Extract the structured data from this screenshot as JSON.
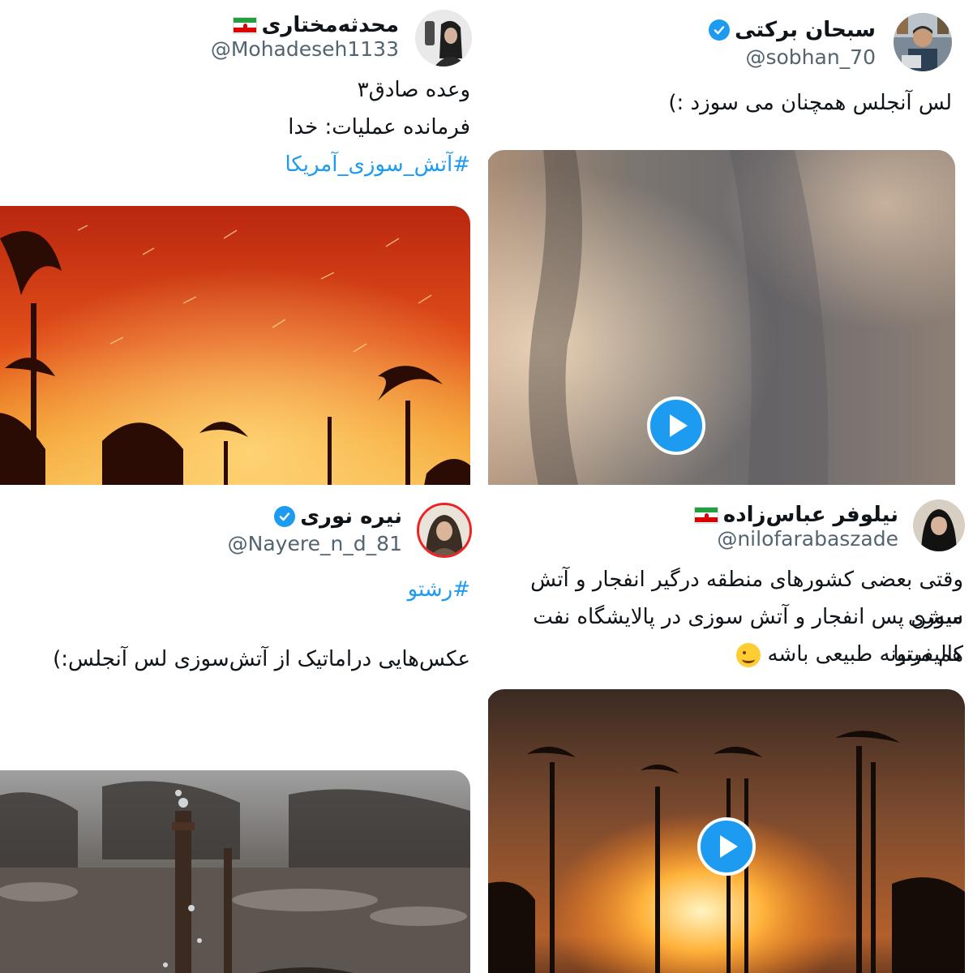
{
  "tweets": [
    {
      "name": "سبحان برکتی",
      "handle": "@sobhan_70",
      "verified": true,
      "text": "لس آنجلس همچنان می سوزد :)",
      "media": "video",
      "avatar_icon": "profile-photo-man-laptop"
    },
    {
      "name": "محدثه‌مختاری",
      "handle": "@Mohadeseh1133",
      "flag": "iran-flag",
      "lines": [
        "وعده صادق۳",
        "فرمانده عملیات: خدا"
      ],
      "hashtag": "#آتش_سوزی_آمریکا",
      "media": "image",
      "avatar_icon": "profile-photo-woman"
    },
    {
      "name": "نیلوفر عباس‌زاده",
      "handle": "@nilofarabaszade",
      "flag": "iran-flag",
      "lines": [
        "وقتی بعضی کشورهای منطقه درگیر انفجار و آتش سوزی",
        "میشن پس انفجار و آتش سوزی در پالایشگاه نفت کالیفرنیا",
        "هم میتونه طبیعی باشه"
      ],
      "emoji": "winking-face-emoji",
      "media": "video",
      "avatar_icon": "profile-photo-woman-chador"
    },
    {
      "name": "نیره نوری",
      "handle": "@Nayere_n_d_81",
      "verified": true,
      "hashtag": "#رشتو",
      "text": "عکس‌هایی دراماتیک از آتش‌سوزی لس آنجلس:)",
      "media": "image",
      "avatar_icon": "profile-photo-woman-hijab"
    }
  ],
  "colors": {
    "accent": "#1d9bf0",
    "text": "#0f1419",
    "muted": "#536471"
  }
}
